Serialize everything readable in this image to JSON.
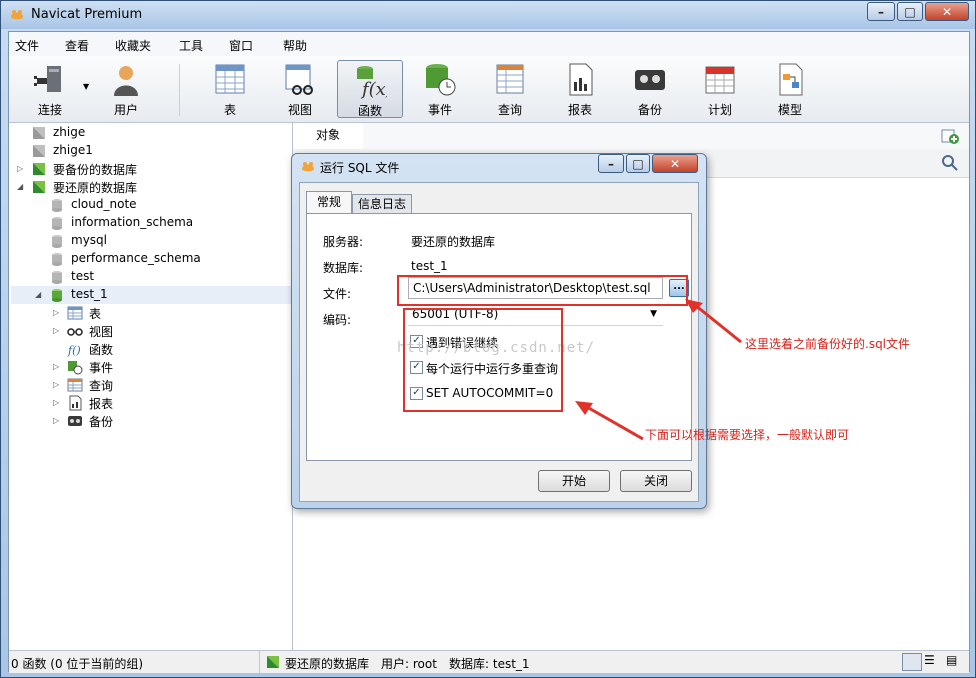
{
  "window": {
    "title": "Navicat Premium"
  },
  "menu": [
    "文件",
    "查看",
    "收藏夹",
    "工具",
    "窗口",
    "帮助"
  ],
  "toolbar": {
    "connect": "连接",
    "user": "用户",
    "table": "表",
    "view": "视图",
    "function": "函数",
    "event": "事件",
    "query": "查询",
    "report": "报表",
    "backup": "备份",
    "schedule": "计划",
    "model": "模型"
  },
  "tree": {
    "conn1": "zhige",
    "conn2": "zhige1",
    "conn3": "要备份的数据库",
    "conn4": "要还原的数据库",
    "dbs": [
      "cloud_note",
      "information_schema",
      "mysql",
      "performance_schema",
      "test",
      "test_1"
    ],
    "objects": {
      "table": "表",
      "view": "视图",
      "function": "函数",
      "event": "事件",
      "query": "查询",
      "report": "报表",
      "backup": "备份"
    }
  },
  "main": {
    "object_tab": "对象"
  },
  "dialog": {
    "title": "运行 SQL 文件",
    "tab_general": "常规",
    "tab_log": "信息日志",
    "server_label": "服务器:",
    "server_value": "要还原的数据库",
    "database_label": "数据库:",
    "database_value": "test_1",
    "file_label": "文件:",
    "file_value": "C:\\Users\\Administrator\\Desktop\\test.sql",
    "browse_label": "...",
    "encoding_label": "编码:",
    "encoding_value": "65001 (UTF-8)",
    "opt_continue": "遇到错误继续",
    "opt_multi": "每个运行中运行多重查询",
    "opt_autocommit": "SET AUTOCOMMIT=0",
    "start_button": "开始",
    "close_button": "关闭"
  },
  "annotations": {
    "file_note": "这里选着之前备份好的.sql文件",
    "options_note": "下面可以根据需要选择，一般默认即可"
  },
  "watermark": "http://blog.csdn.net/",
  "status": {
    "left": "0 函数 (0 位于当前的组)",
    "conn": "要还原的数据库",
    "user": "用户: root",
    "db": "数据库: test_1"
  },
  "colors": {
    "annotation": "#e0312a",
    "accent": "#2f7d32"
  }
}
